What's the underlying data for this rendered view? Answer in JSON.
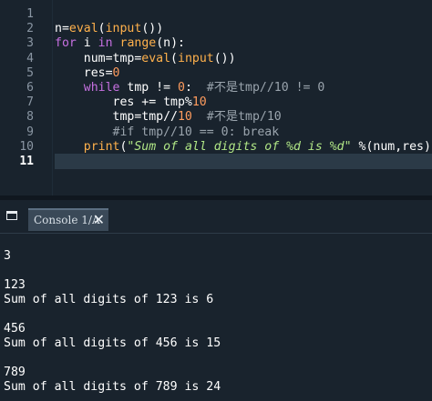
{
  "editor": {
    "line_numbers": [
      "1",
      "2",
      "3",
      "4",
      "5",
      "6",
      "7",
      "8",
      "9",
      "10",
      "11"
    ],
    "active_line": "11",
    "lines": [
      {
        "segments": []
      },
      {
        "segments": [
          {
            "t": "n=",
            "c": "plain"
          },
          {
            "t": "eval",
            "c": "fn"
          },
          {
            "t": "(",
            "c": "plain"
          },
          {
            "t": "input",
            "c": "fn"
          },
          {
            "t": "())",
            "c": "plain"
          }
        ]
      },
      {
        "segments": [
          {
            "t": "for",
            "c": "kw"
          },
          {
            "t": " i ",
            "c": "plain"
          },
          {
            "t": "in",
            "c": "kw"
          },
          {
            "t": " ",
            "c": "plain"
          },
          {
            "t": "range",
            "c": "fn"
          },
          {
            "t": "(n):",
            "c": "plain"
          }
        ]
      },
      {
        "segments": [
          {
            "t": "    num=tmp=",
            "c": "plain"
          },
          {
            "t": "eval",
            "c": "fn"
          },
          {
            "t": "(",
            "c": "plain"
          },
          {
            "t": "input",
            "c": "fn"
          },
          {
            "t": "())",
            "c": "plain"
          }
        ]
      },
      {
        "segments": [
          {
            "t": "    res=",
            "c": "plain"
          },
          {
            "t": "0",
            "c": "num"
          }
        ]
      },
      {
        "segments": [
          {
            "t": "    ",
            "c": "plain"
          },
          {
            "t": "while",
            "c": "kw"
          },
          {
            "t": " tmp != ",
            "c": "plain"
          },
          {
            "t": "0",
            "c": "num"
          },
          {
            "t": ":  ",
            "c": "plain"
          },
          {
            "t": "#不是tmp//10 != 0",
            "c": "cm"
          }
        ]
      },
      {
        "segments": [
          {
            "t": "        res += tmp%",
            "c": "plain"
          },
          {
            "t": "10",
            "c": "num"
          }
        ]
      },
      {
        "segments": [
          {
            "t": "        tmp=tmp//",
            "c": "plain"
          },
          {
            "t": "10",
            "c": "num"
          },
          {
            "t": "  ",
            "c": "plain"
          },
          {
            "t": "#不是tmp/10",
            "c": "cm"
          }
        ]
      },
      {
        "segments": [
          {
            "t": "        ",
            "c": "plain"
          },
          {
            "t": "#if tmp//10 == 0: break",
            "c": "cm"
          }
        ]
      },
      {
        "segments": [
          {
            "t": "    ",
            "c": "plain"
          },
          {
            "t": "print",
            "c": "fn"
          },
          {
            "t": "(",
            "c": "plain"
          },
          {
            "t": "\"Sum of all digits of %d is %d\"",
            "c": "st"
          },
          {
            "t": " %(num,res))",
            "c": "plain"
          }
        ]
      },
      {
        "segments": []
      }
    ]
  },
  "console_tab": {
    "label": "Console 1/A",
    "close_glyph": "✕",
    "icon": "panel-icon"
  },
  "console_output": [
    "3",
    "",
    "123",
    "Sum of all digits of 123 is 6",
    "",
    "456",
    "Sum of all digits of 456 is 15",
    "",
    "789",
    "Sum of all digits of 789 is 24"
  ],
  "colors": {
    "background": "#19232d",
    "keyword": "#c670e0",
    "builtin": "#ffb14c",
    "number": "#ff9c5e",
    "comment": "#9aa4ad",
    "string": "#b0e686"
  }
}
